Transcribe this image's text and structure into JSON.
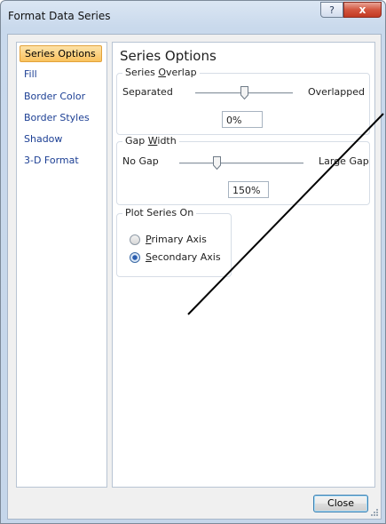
{
  "window": {
    "title": "Format Data Series",
    "help_label": "?",
    "close_label": "x"
  },
  "nav": {
    "items": [
      {
        "label": "Series Options",
        "selected": true
      },
      {
        "label": "Fill",
        "selected": false
      },
      {
        "label": "Border Color",
        "selected": false
      },
      {
        "label": "Border Styles",
        "selected": false
      },
      {
        "label": "Shadow",
        "selected": false
      },
      {
        "label": "3-D Format",
        "selected": false
      }
    ]
  },
  "panel": {
    "title": "Series Options",
    "overlap": {
      "label_pre": "Series ",
      "label_key": "O",
      "label_post": "verlap",
      "min_label": "Separated",
      "max_label": "Overlapped",
      "value": "0%",
      "slider_fraction": 0.5
    },
    "gap": {
      "label_pre": "Gap ",
      "label_key": "W",
      "label_post": "idth",
      "min_label": "No Gap",
      "max_label": "Large Gap",
      "value": "150%",
      "slider_fraction": 0.3
    },
    "plot_on": {
      "label": "Plot Series On",
      "options": [
        {
          "key": "P",
          "rest": "rimary Axis",
          "checked": false
        },
        {
          "key": "S",
          "rest": "econdary Axis",
          "checked": true
        }
      ]
    }
  },
  "footer": {
    "close_label": "Close"
  }
}
